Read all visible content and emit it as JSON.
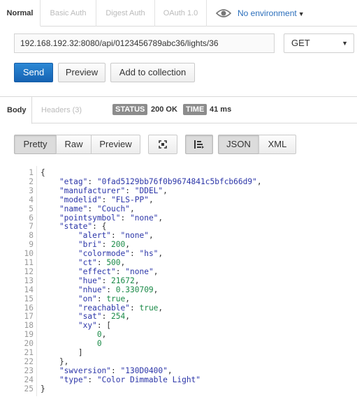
{
  "auth_tabs": [
    {
      "label": "Normal",
      "active": true
    },
    {
      "label": "Basic Auth",
      "active": false
    },
    {
      "label": "Digest Auth",
      "active": false
    },
    {
      "label": "OAuth 1.0",
      "active": false
    }
  ],
  "environment": {
    "label": "No environment",
    "icon": "eye-icon"
  },
  "request": {
    "url": "192.168.192.32:8080/api/0123456789abc36/lights/36",
    "method": "GET"
  },
  "actions": {
    "send_label": "Send",
    "preview_label": "Preview",
    "add_label": "Add to collection"
  },
  "response_tabs": [
    {
      "label": "Body",
      "active": true
    },
    {
      "label": "Headers (3)",
      "active": false
    }
  ],
  "status": {
    "status_label": "STATUS",
    "status_value": "200 OK",
    "time_label": "TIME",
    "time_value": "41 ms"
  },
  "view_buttons": {
    "pretty": "Pretty",
    "raw": "Raw",
    "preview": "Preview"
  },
  "format_buttons": {
    "json": "JSON",
    "xml": "XML"
  },
  "colors": {
    "accent": "#1a6ebd",
    "link": "#2a6ebb",
    "badge": "#8c8c8c",
    "key": "#2b35a8",
    "number": "#1a8a47"
  },
  "code_lines": [
    {
      "n": "1",
      "parts": [
        {
          "t": "{",
          "c": "p"
        }
      ]
    },
    {
      "n": "2",
      "parts": [
        {
          "t": "    \"etag\"",
          "c": "k"
        },
        {
          "t": ": ",
          "c": "p"
        },
        {
          "t": "\"0fad5129bb76f0b9674841c5bfcb66d9\"",
          "c": "s"
        },
        {
          "t": ",",
          "c": "p"
        }
      ]
    },
    {
      "n": "3",
      "parts": [
        {
          "t": "    \"manufacturer\"",
          "c": "k"
        },
        {
          "t": ": ",
          "c": "p"
        },
        {
          "t": "\"DDEL\"",
          "c": "s"
        },
        {
          "t": ",",
          "c": "p"
        }
      ]
    },
    {
      "n": "4",
      "parts": [
        {
          "t": "    \"modelid\"",
          "c": "k"
        },
        {
          "t": ": ",
          "c": "p"
        },
        {
          "t": "\"FLS-PP\"",
          "c": "s"
        },
        {
          "t": ",",
          "c": "p"
        }
      ]
    },
    {
      "n": "5",
      "parts": [
        {
          "t": "    \"name\"",
          "c": "k"
        },
        {
          "t": ": ",
          "c": "p"
        },
        {
          "t": "\"Couch\"",
          "c": "s"
        },
        {
          "t": ",",
          "c": "p"
        }
      ]
    },
    {
      "n": "6",
      "parts": [
        {
          "t": "    \"pointsymbol\"",
          "c": "k"
        },
        {
          "t": ": ",
          "c": "p"
        },
        {
          "t": "\"none\"",
          "c": "s"
        },
        {
          "t": ",",
          "c": "p"
        }
      ]
    },
    {
      "n": "7",
      "parts": [
        {
          "t": "    \"state\"",
          "c": "k"
        },
        {
          "t": ": {",
          "c": "p"
        }
      ]
    },
    {
      "n": "8",
      "parts": [
        {
          "t": "        \"alert\"",
          "c": "k"
        },
        {
          "t": ": ",
          "c": "p"
        },
        {
          "t": "\"none\"",
          "c": "s"
        },
        {
          "t": ",",
          "c": "p"
        }
      ]
    },
    {
      "n": "9",
      "parts": [
        {
          "t": "        \"bri\"",
          "c": "k"
        },
        {
          "t": ": ",
          "c": "p"
        },
        {
          "t": "200",
          "c": "n"
        },
        {
          "t": ",",
          "c": "p"
        }
      ]
    },
    {
      "n": "10",
      "parts": [
        {
          "t": "        \"colormode\"",
          "c": "k"
        },
        {
          "t": ": ",
          "c": "p"
        },
        {
          "t": "\"hs\"",
          "c": "s"
        },
        {
          "t": ",",
          "c": "p"
        }
      ]
    },
    {
      "n": "11",
      "parts": [
        {
          "t": "        \"ct\"",
          "c": "k"
        },
        {
          "t": ": ",
          "c": "p"
        },
        {
          "t": "500",
          "c": "n"
        },
        {
          "t": ",",
          "c": "p"
        }
      ]
    },
    {
      "n": "12",
      "parts": [
        {
          "t": "        \"effect\"",
          "c": "k"
        },
        {
          "t": ": ",
          "c": "p"
        },
        {
          "t": "\"none\"",
          "c": "s"
        },
        {
          "t": ",",
          "c": "p"
        }
      ]
    },
    {
      "n": "13",
      "parts": [
        {
          "t": "        \"hue\"",
          "c": "k"
        },
        {
          "t": ": ",
          "c": "p"
        },
        {
          "t": "21672",
          "c": "n"
        },
        {
          "t": ",",
          "c": "p"
        }
      ]
    },
    {
      "n": "14",
      "parts": [
        {
          "t": "        \"nhue\"",
          "c": "k"
        },
        {
          "t": ": ",
          "c": "p"
        },
        {
          "t": "0.330709",
          "c": "n"
        },
        {
          "t": ",",
          "c": "p"
        }
      ]
    },
    {
      "n": "15",
      "parts": [
        {
          "t": "        \"on\"",
          "c": "k"
        },
        {
          "t": ": ",
          "c": "p"
        },
        {
          "t": "true",
          "c": "b"
        },
        {
          "t": ",",
          "c": "p"
        }
      ]
    },
    {
      "n": "16",
      "parts": [
        {
          "t": "        \"reachable\"",
          "c": "k"
        },
        {
          "t": ": ",
          "c": "p"
        },
        {
          "t": "true",
          "c": "b"
        },
        {
          "t": ",",
          "c": "p"
        }
      ]
    },
    {
      "n": "17",
      "parts": [
        {
          "t": "        \"sat\"",
          "c": "k"
        },
        {
          "t": ": ",
          "c": "p"
        },
        {
          "t": "254",
          "c": "n"
        },
        {
          "t": ",",
          "c": "p"
        }
      ]
    },
    {
      "n": "18",
      "parts": [
        {
          "t": "        \"xy\"",
          "c": "k"
        },
        {
          "t": ": [",
          "c": "p"
        }
      ]
    },
    {
      "n": "19",
      "parts": [
        {
          "t": "            0",
          "c": "n"
        },
        {
          "t": ",",
          "c": "p"
        }
      ]
    },
    {
      "n": "20",
      "parts": [
        {
          "t": "            0",
          "c": "n"
        }
      ]
    },
    {
      "n": "21",
      "parts": [
        {
          "t": "        ]",
          "c": "p"
        }
      ]
    },
    {
      "n": "22",
      "parts": [
        {
          "t": "    },",
          "c": "p"
        }
      ]
    },
    {
      "n": "23",
      "parts": [
        {
          "t": "    \"swversion\"",
          "c": "k"
        },
        {
          "t": ": ",
          "c": "p"
        },
        {
          "t": "\"130D0400\"",
          "c": "s"
        },
        {
          "t": ",",
          "c": "p"
        }
      ]
    },
    {
      "n": "24",
      "parts": [
        {
          "t": "    \"type\"",
          "c": "k"
        },
        {
          "t": ": ",
          "c": "p"
        },
        {
          "t": "\"Color Dimmable Light\"",
          "c": "s"
        }
      ]
    },
    {
      "n": "25",
      "parts": [
        {
          "t": "}",
          "c": "p"
        }
      ]
    }
  ]
}
